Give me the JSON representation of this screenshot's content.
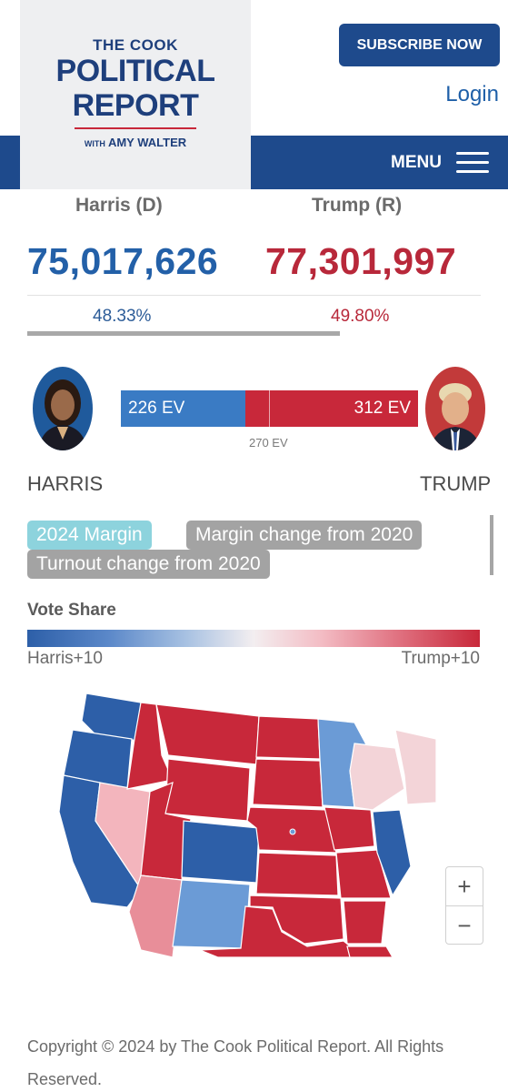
{
  "header": {
    "logo": {
      "line1": "THE COOK",
      "line2": "POLITICAL",
      "line3": "REPORT",
      "line4_small": "WITH",
      "line4": "AMY WALTER"
    },
    "subscribe_label": "SUBSCRIBE NOW",
    "login_label": "Login",
    "menu_label": "MENU"
  },
  "popular_vote": {
    "harris": {
      "name": "Harris (D)",
      "votes": "75,017,626",
      "pct": "48.33%"
    },
    "trump": {
      "name": "Trump (R)",
      "votes": "77,301,997",
      "pct": "49.80%"
    }
  },
  "electoral": {
    "harris_ev": "226 EV",
    "trump_ev": "312 EV",
    "threshold": "270 EV",
    "harris_label": "HARRIS",
    "trump_label": "TRUMP",
    "harris_value": 226,
    "trump_value": 312
  },
  "tabs": [
    {
      "label": "2024 Margin",
      "active": true
    },
    {
      "label": "Margin change from 2020",
      "active": false
    },
    {
      "label": "Turnout change from 2020",
      "active": false
    }
  ],
  "legend": {
    "title": "Vote Share",
    "left": "Harris+10",
    "right": "Trump+10"
  },
  "colors": {
    "dem_strong": "#2d5fa8",
    "dem_lean": "#6b9bd6",
    "rep_strong": "#c8283a",
    "rep_lean": "#e88e99",
    "rep_tilt": "#f5c9cf",
    "brand_blue": "#1e4a8c",
    "tab_active": "#8dd3dd",
    "tab_inactive": "#a3a3a3"
  },
  "map_controls": {
    "zoom_in": "+",
    "zoom_out": "−"
  },
  "footer": {
    "copyright": "Copyright © 2024 by The Cook Political Report. All Rights Reserved."
  }
}
